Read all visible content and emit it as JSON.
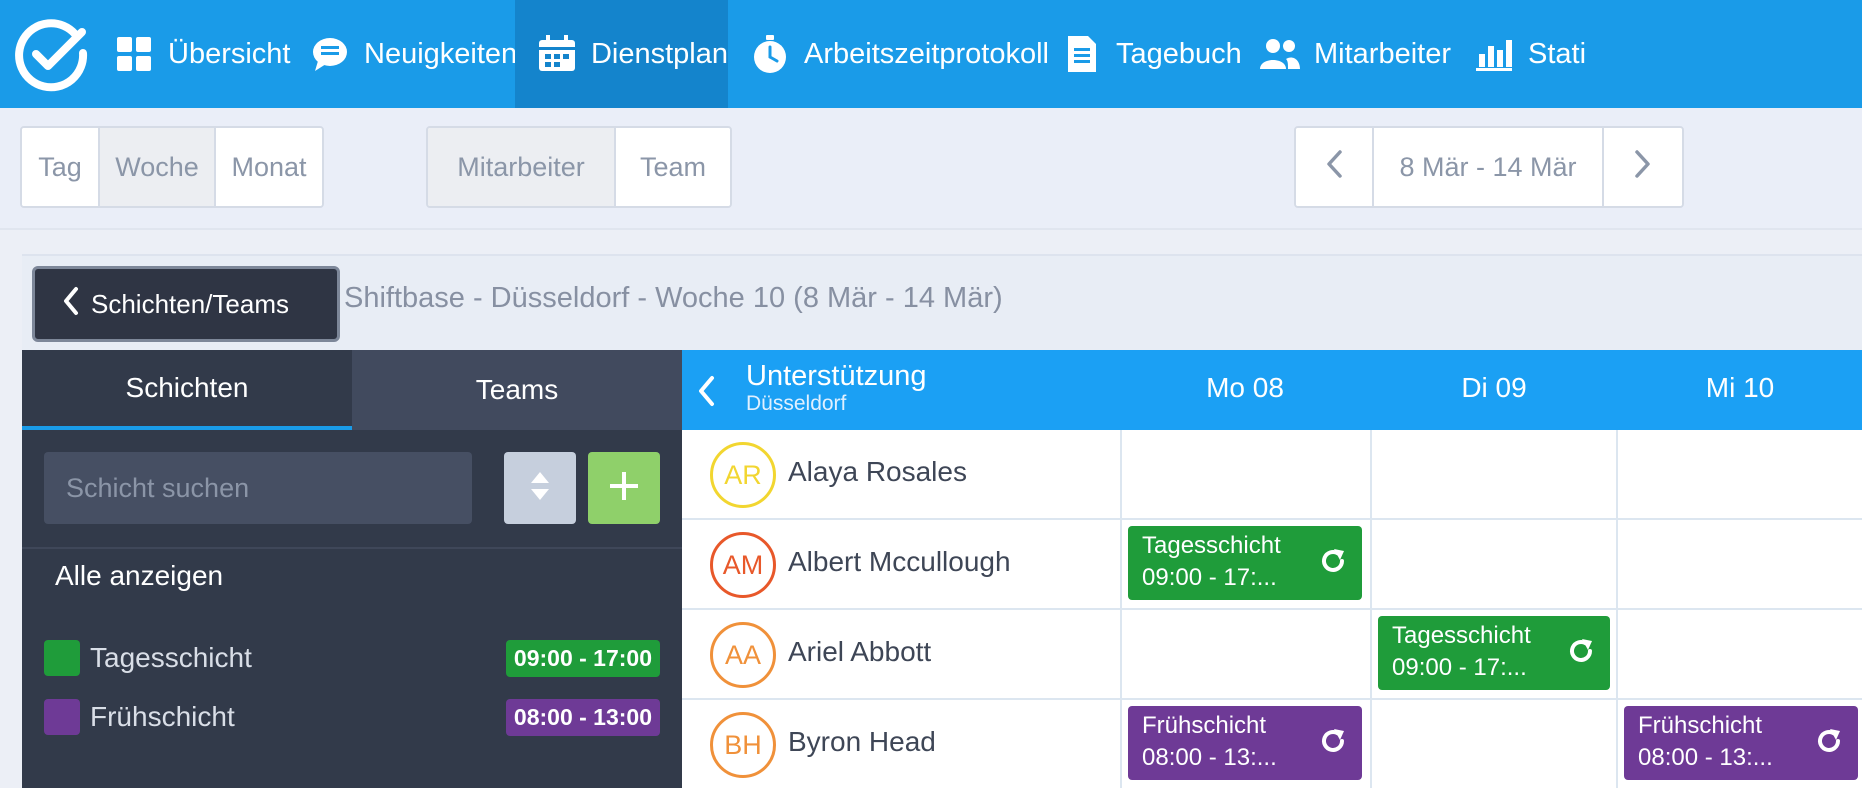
{
  "nav": {
    "items": [
      {
        "label": "Übersicht",
        "icon": "grid-icon"
      },
      {
        "label": "Neuigkeiten",
        "icon": "chat-icon"
      },
      {
        "label": "Dienstplan",
        "icon": "calendar-icon",
        "active": true
      },
      {
        "label": "Arbeitszeitprotokoll",
        "icon": "stopwatch-icon"
      },
      {
        "label": "Tagebuch",
        "icon": "document-icon"
      },
      {
        "label": "Mitarbeiter",
        "icon": "users-icon"
      },
      {
        "label": "Stati",
        "icon": "bar-chart-icon"
      }
    ]
  },
  "toolbar": {
    "view_modes": [
      "Tag",
      "Woche",
      "Monat"
    ],
    "active_view": "Woche",
    "group_modes": [
      "Mitarbeiter",
      "Team"
    ],
    "active_group": "Mitarbeiter",
    "date_range": "8 Mär - 14 Mär"
  },
  "breadcrumb": {
    "back_label": "Schichten/Teams",
    "title": "Shiftbase - Düsseldorf - Woche 10 (8 Mär - 14 Mär)"
  },
  "sidebar": {
    "tabs": [
      "Schichten",
      "Teams"
    ],
    "search_placeholder": "Schicht suchen",
    "show_all": "Alle anzeigen",
    "shifts": [
      {
        "name": "Tagesschicht",
        "time": "09:00 - 17:00",
        "color": "#1f9c3a"
      },
      {
        "name": "Frühschicht",
        "time": "08:00 - 13:00",
        "color": "#6e3a96"
      }
    ]
  },
  "schedule": {
    "team": "Unterstützung",
    "location": "Düsseldorf",
    "days": [
      "Mo 08",
      "Di 09",
      "Mi 10"
    ],
    "employees": [
      {
        "initials": "AR",
        "name": "Alaya Rosales",
        "color": "#f2d630"
      },
      {
        "initials": "AM",
        "name": "Albert Mccullough",
        "color": "#e8582a"
      },
      {
        "initials": "AA",
        "name": "Ariel Abbott",
        "color": "#f0913a"
      },
      {
        "initials": "BH",
        "name": "Byron Head",
        "color": "#f0913a"
      }
    ],
    "shift_cards": [
      {
        "title": "Tagesschicht",
        "time": "09:00 - 17:...",
        "color": "#1f9c3a"
      },
      {
        "title": "Tagesschicht",
        "time": "09:00 - 17:...",
        "color": "#1f9c3a"
      },
      {
        "title": "Frühschicht",
        "time": "08:00 - 13:...",
        "color": "#6e3a96"
      },
      {
        "title": "Frühschicht",
        "time": "08:00 - 13:...",
        "color": "#6e3a96"
      }
    ]
  }
}
